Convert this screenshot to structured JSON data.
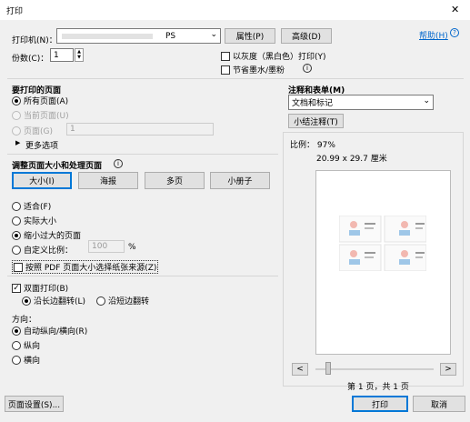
{
  "window": {
    "title": "打印",
    "close_glyph": "✕"
  },
  "printer": {
    "label": "打印机(N)：",
    "selected_suffix": "PS",
    "properties_button": "属性(P)",
    "advanced_button": "高级(D)",
    "help_link": "帮助(H)",
    "copies_label": "份数(C)：",
    "copies_value": "1",
    "grayscale_label": "以灰度（黑白色）打印(Y)",
    "save_ink_label": "节省墨水/墨粉"
  },
  "pages_to_print": {
    "heading": "要打印的页面",
    "all_pages": "所有页面(A)",
    "current_page": "当前页面(U)",
    "pages": "页面(G)",
    "pages_value": "1",
    "more_options": "更多选项"
  },
  "comments_forms": {
    "heading": "注释和表单(M)",
    "selected": "文档和标记",
    "summarize_button": "小结注释(T)"
  },
  "size_handling": {
    "heading": "调整页面大小和处理页面",
    "tabs": [
      "大小(I)",
      "海报",
      "多页",
      "小册子"
    ],
    "fit": "适合(F)",
    "actual_size": "实际大小",
    "shrink_oversized": "缩小过大的页面",
    "custom_scale": "自定义比例：",
    "custom_scale_value": "100",
    "percent": "%",
    "choose_paper_source": "按照 PDF 页面大小选择纸张来源(Z)"
  },
  "duplex": {
    "label": "双面打印(B)",
    "long_edge": "沿长边翻转(L)",
    "short_edge": "沿短边翻转"
  },
  "orientation": {
    "heading": "方向：",
    "auto": "自动纵向/横向(R)",
    "portrait": "纵向",
    "landscape": "横向"
  },
  "preview": {
    "scale_text": "比例： 97%",
    "paper_size": "20.99 x 29.7 厘米",
    "page_status": "第 1 页，共 1 页",
    "prev_glyph": "<",
    "next_glyph": ">"
  },
  "footer": {
    "page_setup_button": "页面设置(S)...",
    "print_button": "打印",
    "cancel_button": "取消"
  },
  "colors": {
    "accent": "#0078d7",
    "link": "#0066cc"
  }
}
